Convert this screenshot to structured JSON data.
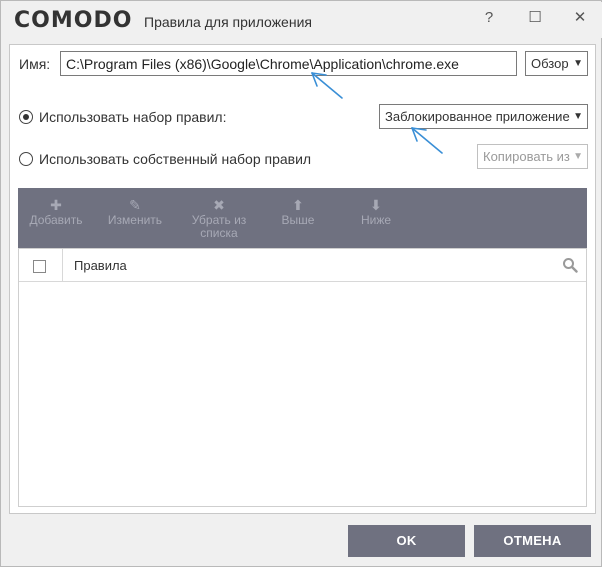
{
  "window": {
    "logo": "COMODO",
    "title": "Правила для приложения",
    "help_label": "?",
    "minimize_label": "☐",
    "close_label": "✕"
  },
  "form": {
    "name_label": "Имя:",
    "path_value": "C:\\Program Files (x86)\\Google\\Chrome\\Application\\chrome.exe",
    "browse_label": "Обзор",
    "use_ruleset_label": "Использовать набор правил:",
    "ruleset_value": "Заблокированное приложение",
    "use_custom_label": "Использовать собственный набор правил",
    "copy_from_label": "Копировать из"
  },
  "toolbar": {
    "add": {
      "icon": "✚",
      "label": "Добавить"
    },
    "edit": {
      "icon": "✎",
      "label": "Изменить"
    },
    "remove": {
      "icon": "✖",
      "label_line1": "Убрать из",
      "label_line2": "списка"
    },
    "up": {
      "icon": "⬆",
      "label": "Выше"
    },
    "down": {
      "icon": "⬇",
      "label": "Ниже"
    }
  },
  "grid": {
    "column_rules": "Правила",
    "rows": []
  },
  "buttons": {
    "ok": "OK",
    "cancel": "ОТМЕНА"
  },
  "colors": {
    "toolbar_bg": "#6f7180",
    "annotation_arrow": "#3a8fd6"
  }
}
